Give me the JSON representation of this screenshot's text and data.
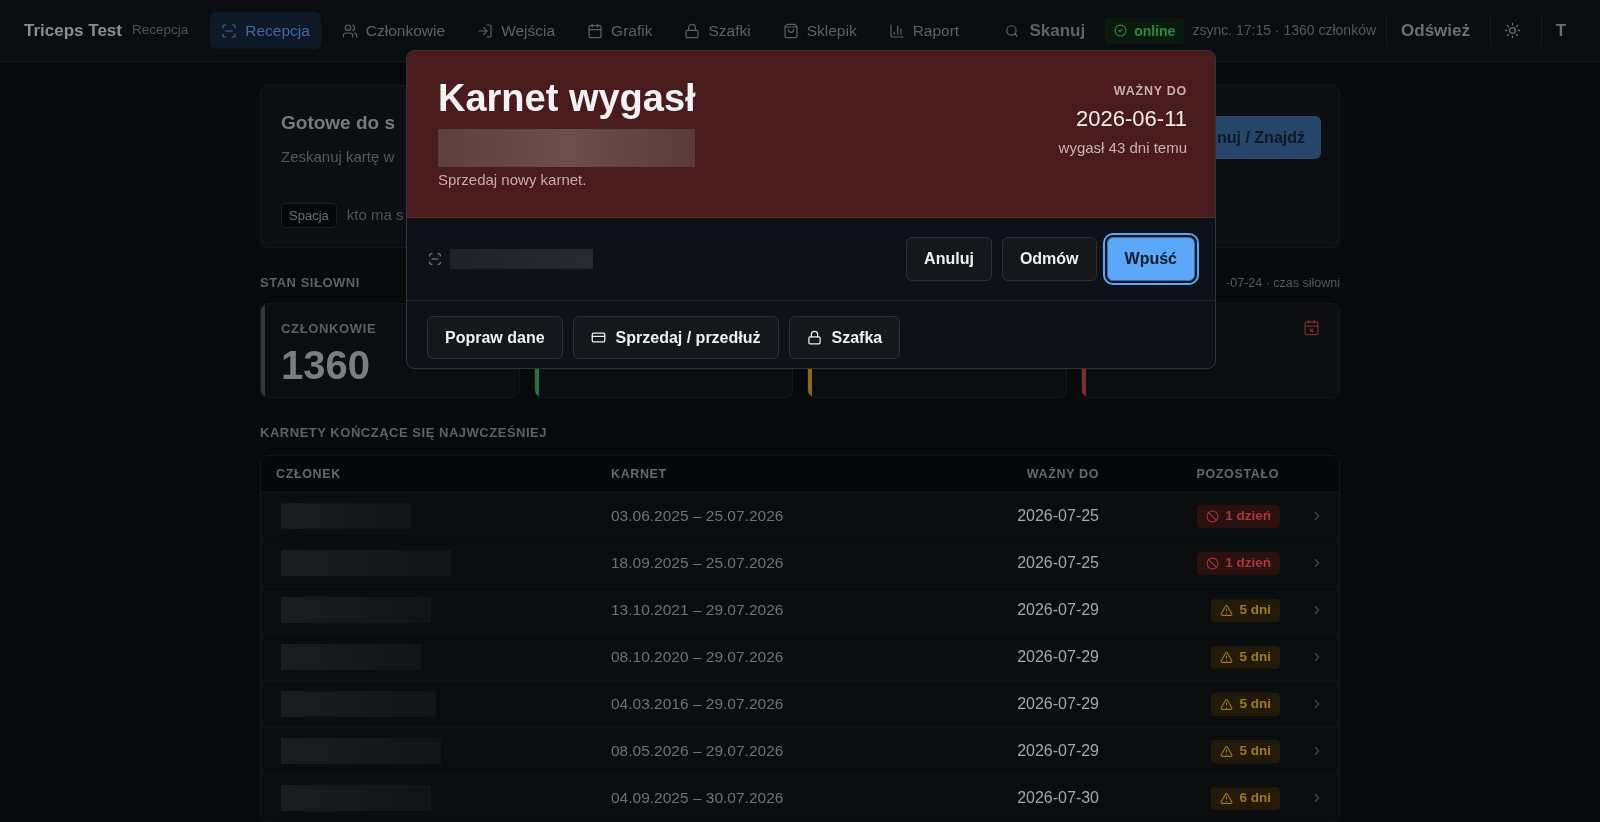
{
  "nav": {
    "brand": "Triceps Test",
    "context": "Recepcja",
    "items": [
      {
        "label": "Recepcja",
        "selected": true
      },
      {
        "label": "Członkowie",
        "selected": false
      },
      {
        "label": "Wejścia",
        "selected": false
      },
      {
        "label": "Grafik",
        "selected": false
      },
      {
        "label": "Szafki",
        "selected": false
      },
      {
        "label": "Sklepik",
        "selected": false
      },
      {
        "label": "Raport",
        "selected": false
      }
    ],
    "scan_button": "Skanuj",
    "status": {
      "label": "online",
      "online": true
    },
    "sync_info": "zsync. 17:15 · 1360 członków",
    "refresh_button": "Odśwież",
    "avatar": "T"
  },
  "ready_card": {
    "title": "Gotowe do s",
    "subtitle": "Zeskanuj kartę w",
    "shortcut_key": "Spacja",
    "shortcut_hint": "kto ma s",
    "button": "nuj / Znajdź"
  },
  "gym_state": {
    "heading": "STAN SIŁOWNI",
    "note": "-07-24 · czas siłowni",
    "cards": [
      {
        "label": "CZŁONKOWIE",
        "value": "1360",
        "color": "#34373c"
      },
      {
        "color": "#2f6e3e"
      },
      {
        "color": "#8a6b1c"
      },
      {
        "color": "#7a302b"
      }
    ]
  },
  "expiring": {
    "heading": "KARNETY KOŃCZĄCE SIĘ NAJWCZEŚNIEJ",
    "columns": [
      "CZŁONEK",
      "KARNET",
      "WAŻNY DO",
      "POZOSTAŁO"
    ],
    "rows": [
      {
        "pass": "03.06.2025 – 25.07.2026",
        "valid_to": "2026-07-25",
        "remaining": "1 dzień",
        "kind": "critical"
      },
      {
        "pass": "18.09.2025 – 25.07.2026",
        "valid_to": "2026-07-25",
        "remaining": "1 dzień",
        "kind": "critical"
      },
      {
        "pass": "13.10.2021 – 29.07.2026",
        "valid_to": "2026-07-29",
        "remaining": "5 dni",
        "kind": "warning"
      },
      {
        "pass": "08.10.2020 – 29.07.2026",
        "valid_to": "2026-07-29",
        "remaining": "5 dni",
        "kind": "warning"
      },
      {
        "pass": "04.03.2016 – 29.07.2026",
        "valid_to": "2026-07-29",
        "remaining": "5 dni",
        "kind": "warning"
      },
      {
        "pass": "08.05.2026 – 29.07.2026",
        "valid_to": "2026-07-29",
        "remaining": "5 dni",
        "kind": "warning"
      },
      {
        "pass": "04.09.2025 – 30.07.2026",
        "valid_to": "2026-07-30",
        "remaining": "6 dni",
        "kind": "warning"
      }
    ]
  },
  "dialog": {
    "title": "Karnet wygasł",
    "message": "Sprzedaj nowy karnet.",
    "valid_label": "WAŻNY DO",
    "valid_date": "2026-06-11",
    "expired_ago": "wygasł 43 dni temu",
    "actions": [
      {
        "label": "Anuluj",
        "kind": "secondary",
        "focused": false
      },
      {
        "label": "Odmów",
        "kind": "secondary",
        "focused": false
      },
      {
        "label": "Wpuść",
        "kind": "primary",
        "focused": true
      }
    ],
    "tools": [
      "Popraw dane",
      "Sprzedaj / przedłuż",
      "Szafka"
    ]
  }
}
